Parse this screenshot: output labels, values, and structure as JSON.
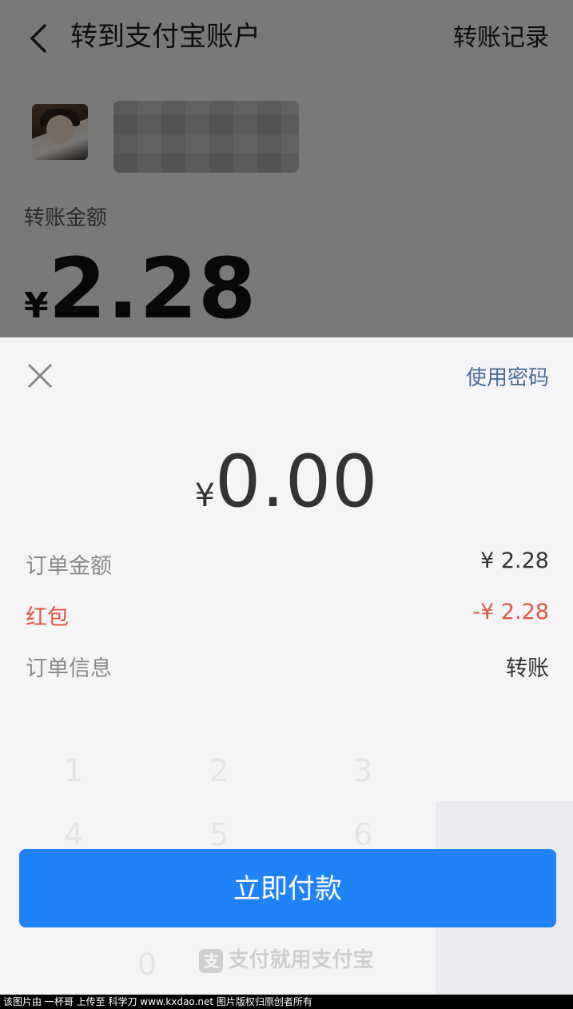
{
  "header": {
    "title": "转到支付宝账户",
    "records_link": "转账记录"
  },
  "transfer": {
    "amount_label": "转账金额",
    "currency": "¥",
    "amount": "2.28"
  },
  "sheet": {
    "use_password": "使用密码",
    "pay_currency": "¥",
    "pay_amount": "0.00",
    "rows": [
      {
        "label": "订单金额",
        "value": "¥ 2.28"
      },
      {
        "label": "红包",
        "value": "-¥ 2.28"
      },
      {
        "label": "订单信息",
        "value": "转账"
      }
    ],
    "pay_button": "立即付款",
    "footer_brand": "支付就用支付宝"
  },
  "colors": {
    "primary_button": "#1f82f8",
    "link": "#4a6e9a",
    "discount_red": "#e0553f"
  },
  "watermark": "该图片由 一杯哥 上传至 科学刀 www.kxdao.net 图片版权归原创者所有"
}
